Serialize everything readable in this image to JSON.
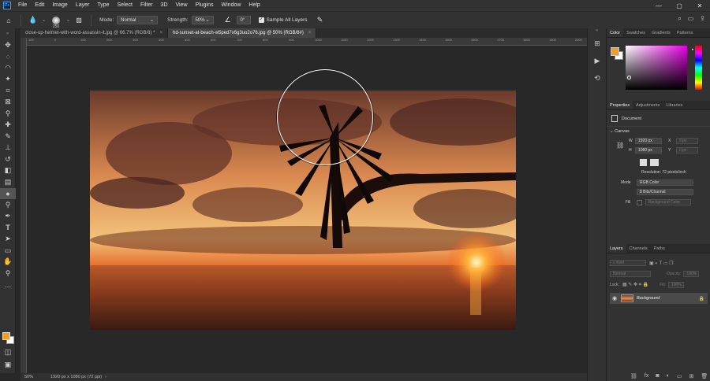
{
  "app": {
    "logo_text": "Ps"
  },
  "menu": [
    "File",
    "Edit",
    "Image",
    "Layer",
    "Type",
    "Select",
    "Filter",
    "3D",
    "View",
    "Plugins",
    "Window",
    "Help"
  ],
  "window_controls": [
    "—",
    "▢",
    "✕"
  ],
  "window_right_icons": [
    "⌕",
    "▭",
    "⇪"
  ],
  "options_bar": {
    "home_icon": "home-icon",
    "brush_size": "250",
    "mode_label": "Mode:",
    "mode_value": "Normal",
    "strength_label": "Strength:",
    "strength_value": "50%",
    "angle_value": "0°",
    "sample_all_layers_label": "Sample All Layers",
    "sample_all_layers_checked": true
  },
  "tabs": [
    {
      "label": "close-up-helmet-with-word-assassin-it.jpg @ 66.7% (RGB/8) *",
      "active": false
    },
    {
      "label": "hd-sunset-at-beach-w5ped7x6g3uo2o76.jpg @ 50% (RGB/8#)",
      "active": true
    }
  ],
  "ruler_top": [
    "100",
    "0",
    "100",
    "200",
    "300",
    "400",
    "500",
    "600",
    "700",
    "800",
    "900",
    "1000",
    "1100",
    "1200",
    "1300",
    "1400",
    "1500",
    "1600",
    "1700",
    "1800",
    "1900",
    "2000",
    "2100"
  ],
  "status": {
    "zoom": "50%",
    "doc_size": "1920 px x 1080 px (72 ppi)"
  },
  "colors": {
    "foreground": "#f0a020",
    "background": "#ffffff",
    "accent": "#31a8ff"
  },
  "color_panel": {
    "tabs": [
      "Color",
      "Swatches",
      "Gradients",
      "Patterns"
    ]
  },
  "properties_panel": {
    "tabs": [
      "Properties",
      "Adjustments",
      "Libraries"
    ],
    "doc_label": "Document",
    "canvas_label": "Canvas",
    "w_label": "W",
    "w_value": "1920 px",
    "h_label": "H",
    "h_value": "1080 px",
    "x_label": "X",
    "x_value": "0 px",
    "y_label": "Y",
    "y_value": "0 px",
    "resolution": "Resolution: 72 pixels/inch",
    "mode_label": "Mode",
    "mode_value": "RGB Color",
    "depth_value": "8 Bits/Channel",
    "fill_label": "Fill",
    "fill_value": "Background Color"
  },
  "layers_panel": {
    "tabs": [
      "Layers",
      "Channels",
      "Paths"
    ],
    "kind_label": "Kind",
    "blend_mode": "Normal",
    "opacity_label": "Opacity:",
    "opacity_value": "100%",
    "lock_label": "Lock:",
    "fill_label": "Fill:",
    "fill_value": "100%",
    "layer_name": "Background"
  },
  "tools": [
    "move-icon",
    "marquee-icon",
    "lasso-icon",
    "quick-select-icon",
    "crop-icon",
    "frame-icon",
    "eyedropper-icon",
    "healing-icon",
    "brush-icon",
    "stamp-icon",
    "history-brush-icon",
    "eraser-icon",
    "gradient-icon",
    "blur-icon",
    "dodge-icon",
    "pen-icon",
    "type-icon",
    "path-select-icon",
    "rectangle-icon",
    "hand-icon",
    "zoom-icon",
    "more-icon"
  ]
}
